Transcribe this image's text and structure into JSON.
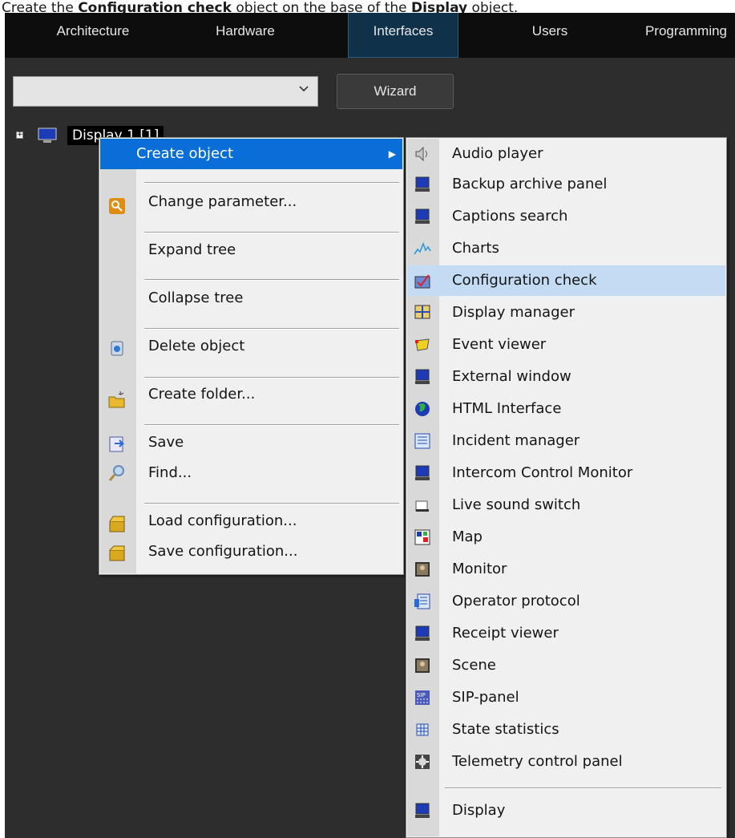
{
  "caption": {
    "prefix": "Create the ",
    "bold1": "Configuration check",
    "middle": " object on the base of the ",
    "bold2": "Display",
    "suffix": " object."
  },
  "tabs": {
    "architecture": "Architecture",
    "hardware": "Hardware",
    "interfaces": "Interfaces",
    "users": "Users",
    "programming": "Programming"
  },
  "toolbar": {
    "combo_value": "",
    "wizard_label": "Wizard"
  },
  "tree": {
    "node_label": "Display 1 [1]"
  },
  "context_menu": {
    "create_object": "Create object",
    "change_parameter": "Change parameter...",
    "expand_tree": "Expand tree",
    "collapse_tree": "Collapse tree",
    "delete_object": "Delete object",
    "create_folder": "Create folder...",
    "save": "Save",
    "find": "Find...",
    "load_configuration": "Load configuration...",
    "save_configuration": "Save configuration..."
  },
  "submenu": {
    "items": [
      "Audio player",
      "Backup archive panel",
      "Captions search",
      "Charts",
      "Configuration check",
      "Display manager",
      "Event viewer",
      "External window",
      "HTML Interface",
      "Incident manager",
      "Intercom Control Monitor",
      "Live sound switch",
      "Map",
      "Monitor",
      "Operator protocol",
      "Receipt viewer",
      "Scene",
      "SIP-panel",
      "State statistics",
      "Telemetry control panel",
      "Display"
    ],
    "highlighted": "Configuration check"
  },
  "colors": {
    "menu_highlight": "#0a6ed8",
    "submenu_highlight": "#c3dcf4",
    "active_tab": "#10314a"
  }
}
